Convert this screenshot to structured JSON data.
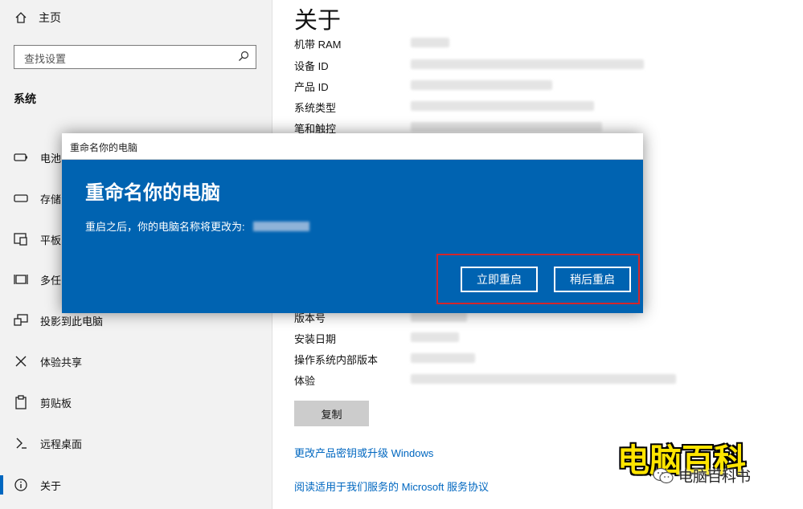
{
  "sidebar": {
    "home_label": "主页",
    "search_placeholder": "查找设置",
    "section_title": "系统",
    "items": [
      {
        "label": "电池",
        "icon": "battery-icon"
      },
      {
        "label": "存储",
        "icon": "storage-icon"
      },
      {
        "label": "平板",
        "icon": "tablet-icon"
      },
      {
        "label": "多任",
        "icon": "multitasking-icon"
      },
      {
        "label": "投影到此电脑",
        "icon": "projecting-icon"
      },
      {
        "label": "体验共享",
        "icon": "shared-experiences-icon"
      },
      {
        "label": "剪贴板",
        "icon": "clipboard-icon"
      },
      {
        "label": "远程桌面",
        "icon": "remote-desktop-icon"
      },
      {
        "label": "关于",
        "icon": "info-icon",
        "active": true
      }
    ]
  },
  "main": {
    "title": "关于",
    "spec_rows": [
      "机带 RAM",
      "设备 ID",
      "产品 ID",
      "系统类型",
      "笔和触控"
    ],
    "os_rows": [
      "版本号",
      "安装日期",
      "操作系统内部版本",
      "体验"
    ],
    "copy_button": "复制",
    "links": [
      "更改产品密钥或升级 Windows",
      "阅读适用于我们服务的 Microsoft 服务协议"
    ]
  },
  "dialog": {
    "window_title": "重命名你的电脑",
    "heading": "重命名你的电脑",
    "message": "重启之后，你的电脑名称将更改为:",
    "restart_now": "立即重启",
    "restart_later": "稍后重启"
  },
  "watermark": {
    "big": "电脑百科",
    "small": "电脑百科书"
  },
  "colors": {
    "dialog_blue": "#0063b1",
    "link_blue": "#0067c0",
    "highlight_red": "#d4262b",
    "watermark_yellow": "#ffe500"
  }
}
